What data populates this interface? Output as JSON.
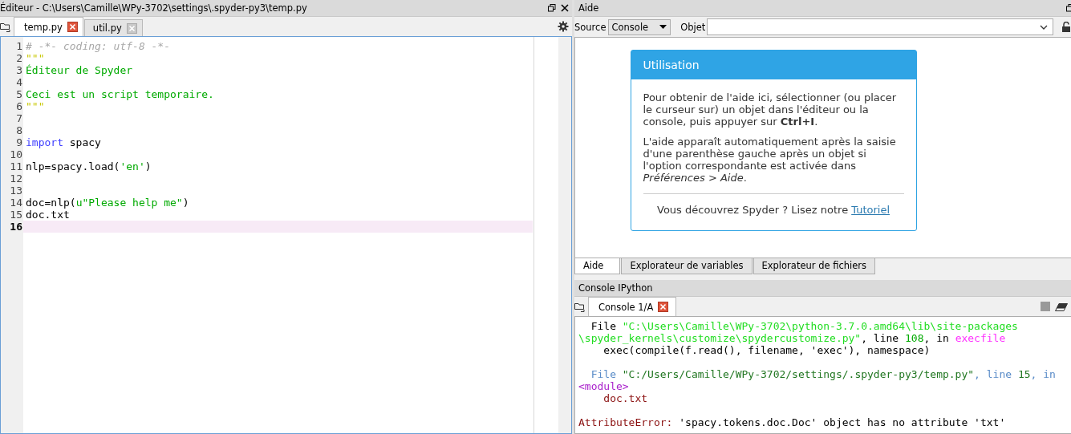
{
  "editor": {
    "title": "Éditeur - C:\\Users\\Camille\\WPy-3702\\settings\\.spyder-py3\\temp.py",
    "tabs": [
      {
        "label": "temp.py",
        "selected": true
      },
      {
        "label": "util.py",
        "selected": false
      }
    ],
    "lines": [
      {
        "number": "1",
        "current": false,
        "tokens": [
          {
            "kind": "comment",
            "text": "# -*- coding: utf-8 -*-"
          }
        ]
      },
      {
        "number": "2",
        "current": false,
        "tokens": [
          {
            "kind": "docstring",
            "text": "\"\"\""
          }
        ]
      },
      {
        "number": "3",
        "current": false,
        "tokens": [
          {
            "kind": "string",
            "text": "Éditeur de Spyder"
          }
        ]
      },
      {
        "number": "4",
        "current": false
      },
      {
        "number": "5",
        "current": false,
        "tokens": [
          {
            "kind": "string",
            "text": "Ceci est un script temporaire."
          }
        ]
      },
      {
        "number": "6",
        "current": false,
        "tokens": [
          {
            "kind": "docstring",
            "text": "\"\"\""
          }
        ]
      },
      {
        "number": "7",
        "current": false
      },
      {
        "number": "8",
        "current": false
      },
      {
        "number": "9",
        "current": false,
        "tokens": [
          {
            "kind": "keyword",
            "text": "import"
          },
          {
            "kind": "plain",
            "text": " spacy"
          }
        ]
      },
      {
        "number": "10",
        "current": false
      },
      {
        "number": "11",
        "current": false,
        "tokens": [
          {
            "kind": "plain",
            "text": "nlp=spacy.load("
          },
          {
            "kind": "string",
            "text": "'en'"
          },
          {
            "kind": "plain",
            "text": ")"
          }
        ]
      },
      {
        "number": "12",
        "current": false
      },
      {
        "number": "13",
        "current": false
      },
      {
        "number": "14",
        "current": false,
        "tokens": [
          {
            "kind": "plain",
            "text": "doc=nlp("
          },
          {
            "kind": "string",
            "text": "u\"Please help me\""
          },
          {
            "kind": "plain",
            "text": ")"
          }
        ]
      },
      {
        "number": "15",
        "current": false,
        "tokens": [
          {
            "kind": "plain",
            "text": "doc.txt"
          }
        ]
      },
      {
        "number": "16",
        "current": true
      }
    ]
  },
  "help": {
    "title": "Aide",
    "source_label": "Source",
    "source_value": "Console",
    "object_label": "Objet",
    "card": {
      "title": "Utilisation",
      "paragraphs": [
        "Pour obtenir de l'aide ici, sélectionner (ou placer le curseur sur) un objet dans l'éditeur ou la console, puis appuyer sur **Ctrl+I**.",
        "L'aide apparaît automatiquement après la saisie d'une parenthèse gauche après un objet si l'option correspondante est activée dans *Préférences > Aide*."
      ],
      "footer_text": "Vous découvrez Spyder ? Lisez notre",
      "footer_link": "Tutoriel"
    },
    "tabs": [
      {
        "label": "Aide",
        "selected": true
      },
      {
        "label": "Explorateur de variables",
        "selected": false
      },
      {
        "label": "Explorateur de fichiers",
        "selected": false
      }
    ]
  },
  "console": {
    "title": "Console IPython",
    "tabs": [
      {
        "label": "Console 1/A",
        "selected": true
      }
    ],
    "blocks": [
      [
        [
          {
            "kind": "plain",
            "text": "  File "
          },
          {
            "kind": "path",
            "text": "\"C:\\Users\\Camille\\WPy-3702\\python-3.7.0.amd64\\lib\\site-packages"
          }
        ],
        [
          {
            "kind": "path",
            "text": "\\spyder_kernels\\customize\\spydercustomize.py\""
          },
          {
            "kind": "plain",
            "text": ", line "
          },
          {
            "kind": "number",
            "text": "108"
          },
          {
            "kind": "plain",
            "text": ", in "
          },
          {
            "kind": "name",
            "text": "execfile"
          }
        ],
        [
          {
            "kind": "plain",
            "text": "    exec(compile(f.read(), filename, 'exec'), namespace)"
          }
        ]
      ],
      [
        [
          {
            "kind": "label",
            "text": "  File "
          },
          {
            "kind": "darkpath",
            "text": "\"C:/Users/Camille/WPy-3702/settings/.spyder-py3/temp.py\""
          },
          {
            "kind": "label",
            "text": ", line "
          },
          {
            "kind": "darkpath",
            "text": "15"
          },
          {
            "kind": "label",
            "text": ", in"
          }
        ],
        [
          {
            "kind": "module",
            "text": "<module>"
          }
        ],
        [
          {
            "kind": "source",
            "text": "    doc.txt"
          }
        ]
      ],
      [
        [
          {
            "kind": "source",
            "text": "AttributeError: "
          },
          {
            "kind": "plain",
            "text": "'spacy.tokens.doc.Doc' object has no attribute 'txt'"
          }
        ]
      ]
    ]
  }
}
